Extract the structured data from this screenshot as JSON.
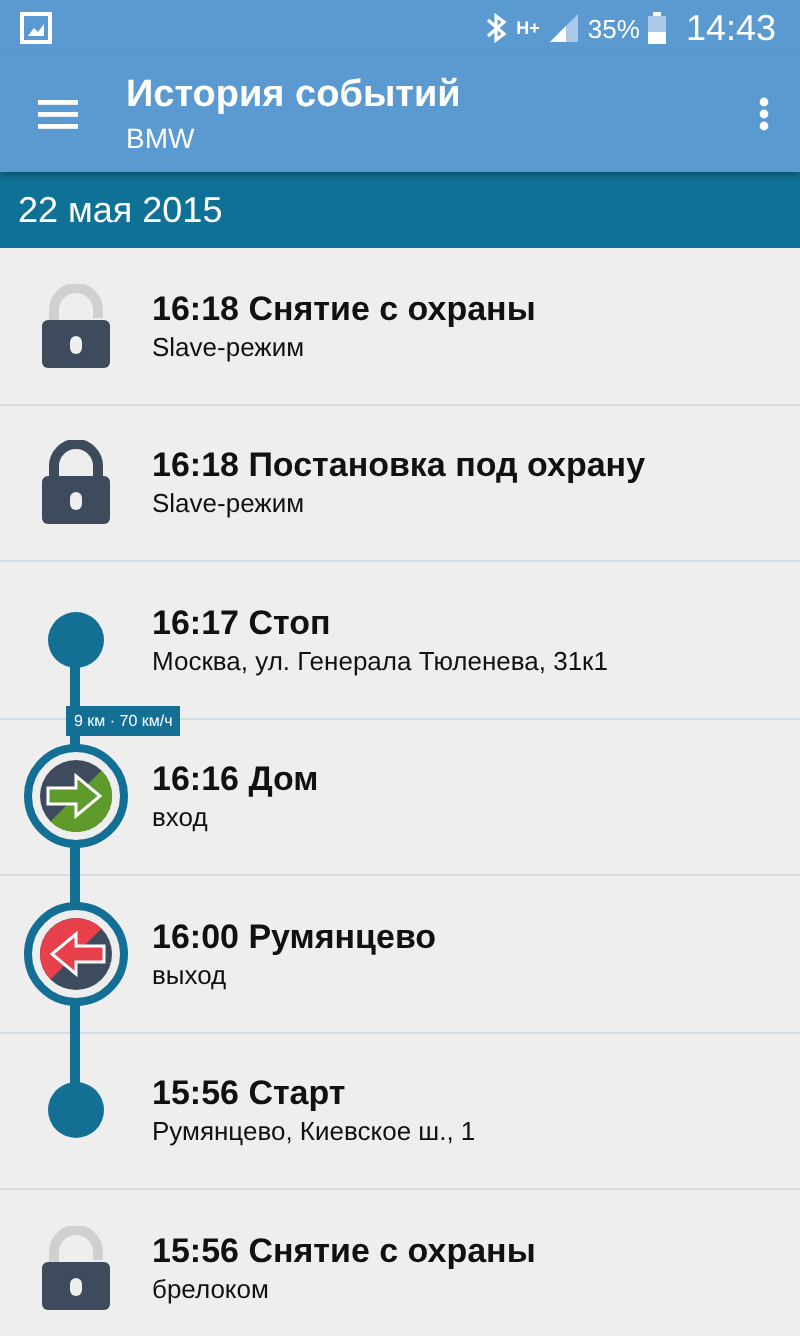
{
  "status_bar": {
    "network": "H+",
    "battery": "35%",
    "time": "14:43"
  },
  "toolbar": {
    "title": "История событий",
    "subtitle": "BMW"
  },
  "date_header": "22 мая 2015",
  "events": [
    {
      "kind": "unlock",
      "title": "16:18 Снятие с охраны",
      "detail": "Slave-режим"
    },
    {
      "kind": "lock",
      "title": "16:18 Постановка под охрану",
      "detail": "Slave-режим"
    },
    {
      "kind": "stop",
      "title": "16:17 Стоп",
      "detail": "Москва, ул. Генерала Тюленева, 31к1",
      "segment": "9 км · 70 км/ч"
    },
    {
      "kind": "enter",
      "title": "16:16 Дом",
      "detail": "вход"
    },
    {
      "kind": "exit",
      "title": "16:00 Румянцево",
      "detail": "выход"
    },
    {
      "kind": "start",
      "title": "15:56 Старт",
      "detail": "Румянцево, Киевское ш., 1"
    },
    {
      "kind": "unlock",
      "title": "15:56 Снятие с охраны",
      "detail": "брелоком"
    }
  ]
}
